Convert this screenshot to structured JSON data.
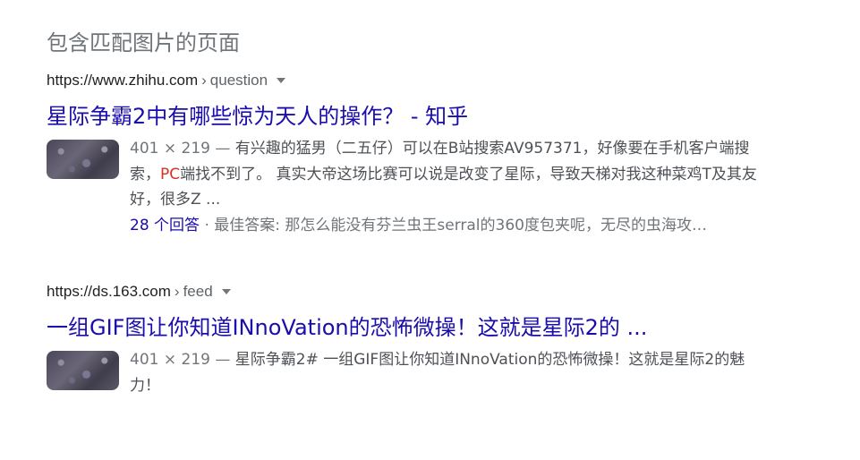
{
  "heading": "包含匹配图片的页面",
  "results": [
    {
      "domain": "https://www.zhihu.com",
      "separator": "›",
      "path": "question",
      "title": "星际争霸2中有哪些惊为天人的操作？ - 知乎",
      "meta": "401 × 219 —",
      "snippet_before": "有兴趣的猛男（二五仔）可以在B站搜索AV957371，好像要在手机客户端搜索，",
      "snippet_highlight": "PC",
      "snippet_after": "端找不到了。 真实大帝这场比赛可以说是改变了星际，导致天梯对我这种菜鸡T及其友好，很多Z ...",
      "answers_link": "28 个回答",
      "answers_rest": " · 最佳答案: 那怎么能没有芬兰虫王serral的360度包夹呢，无尽的虫海攻…"
    },
    {
      "domain": "https://ds.163.com",
      "separator": "›",
      "path": "feed",
      "title": "一组GIF图让你知道INnoVation的恐怖微操！这就是星际2的 ...",
      "meta": "401 × 219 —",
      "snippet_text": "星际争霸2# 一组GIF图让你知道INnoVation的恐怖微操！这就是星际2的魅力！"
    }
  ]
}
